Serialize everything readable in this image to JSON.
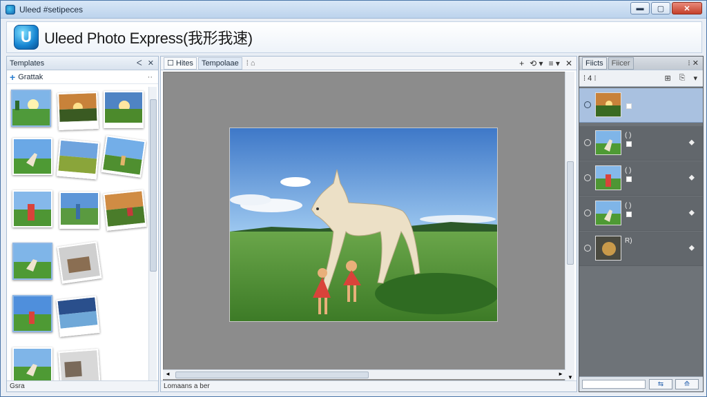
{
  "window": {
    "title": "Uleed #setipeces",
    "buttons": {
      "minimize": "▬",
      "maximize": "▢",
      "close": "✕"
    }
  },
  "app": {
    "logo_letter": "U",
    "title": "Uleed Photo Express(我形我速)"
  },
  "left_panel": {
    "title": "Templates",
    "pin": "ᐸ",
    "close": "✕",
    "sub_label": "Grattak",
    "sub_plus": "+",
    "sub_more": "··",
    "status": "Gsra"
  },
  "center_panel": {
    "tabs": [
      {
        "label": "Hites",
        "icon": "☐"
      },
      {
        "label": "Tempolaae",
        "icon": ""
      }
    ],
    "tab_extra": "⁞ ⌂",
    "controls": [
      "+",
      "⟲ ▾",
      "≡ ▾",
      "✕"
    ],
    "status": "Lomaans a ber",
    "scroll_up": "▲",
    "scroll_down": "▼",
    "scroll_left": "◄",
    "scroll_right": "►"
  },
  "right_panel": {
    "tabs": [
      {
        "label": "Fiicts"
      },
      {
        "label": "Fiicer"
      }
    ],
    "tab_ctrls": "⁝ ✕",
    "tools_left": "⁞ 4 ⁝",
    "tools_right": [
      "⊞",
      "⎘",
      "▾"
    ],
    "layers": [
      {
        "label": "",
        "selected": true,
        "thumb": "sunset",
        "arrow": ""
      },
      {
        "label": "( )",
        "selected": false,
        "thumb": "horse",
        "arrow": "⬥"
      },
      {
        "label": "( )",
        "selected": false,
        "thumb": "girl",
        "arrow": "⬥"
      },
      {
        "label": "( )",
        "selected": false,
        "thumb": "horse",
        "arrow": "⬥"
      },
      {
        "label": "R)",
        "selected": false,
        "thumb": "dog",
        "arrow": "⬥"
      }
    ],
    "bottom_buttons": [
      "⇆",
      "⟰"
    ]
  },
  "colors": {
    "accent": "#2d7fd0",
    "selection": "#a9c1e0",
    "canvas_bg": "#8c8c8c",
    "layers_bg": "#62676c"
  }
}
